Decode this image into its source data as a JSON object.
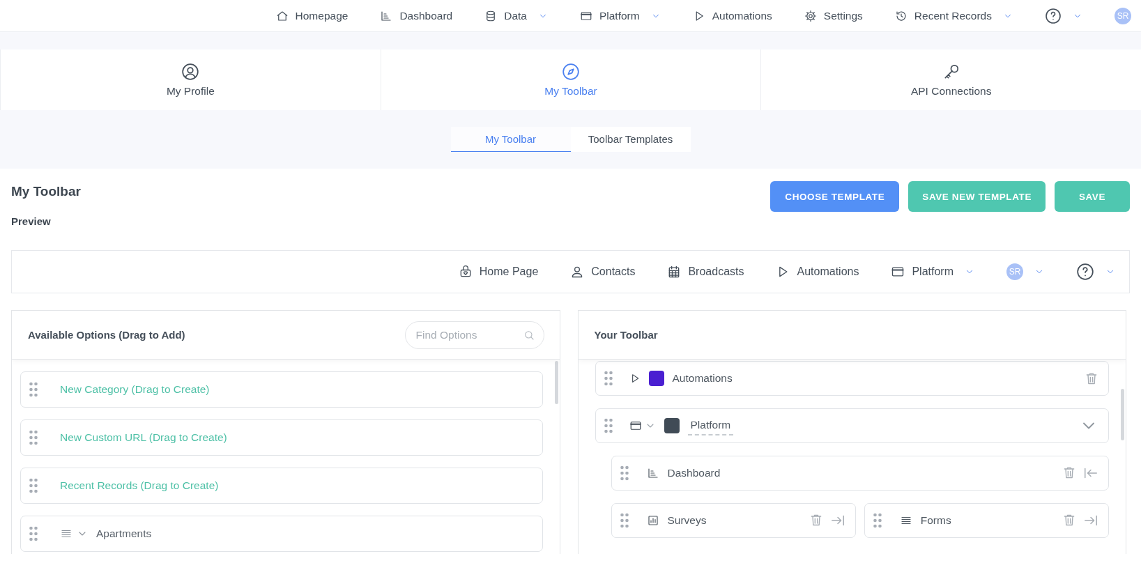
{
  "top_nav": {
    "items": [
      {
        "kind": "link",
        "label": "Homepage",
        "dropdown": false
      },
      {
        "kind": "link",
        "label": "Dashboard",
        "dropdown": false
      },
      {
        "kind": "link",
        "label": "Data",
        "dropdown": true
      },
      {
        "kind": "link",
        "label": "Platform",
        "dropdown": true
      },
      {
        "kind": "link",
        "label": "Automations",
        "dropdown": false
      },
      {
        "kind": "link",
        "label": "Settings",
        "dropdown": false
      },
      {
        "kind": "link",
        "label": "Recent Records",
        "dropdown": true
      },
      {
        "kind": "help",
        "dropdown": true
      },
      {
        "kind": "avatar",
        "label": "SR",
        "dropdown": false
      }
    ]
  },
  "profile_tabs": [
    {
      "label": "My Profile",
      "selected": false
    },
    {
      "label": "My Toolbar",
      "selected": true
    },
    {
      "label": "API Connections",
      "selected": false
    }
  ],
  "sub_tabs": [
    {
      "label": "My Toolbar",
      "selected": true
    },
    {
      "label": "Toolbar Templates",
      "selected": false
    }
  ],
  "page": {
    "title": "My Toolbar",
    "buttons": [
      {
        "label": "CHOOSE TEMPLATE",
        "kind": "primary"
      },
      {
        "label": "SAVE NEW TEMPLATE",
        "kind": "success"
      },
      {
        "label": "SAVE",
        "kind": "success"
      }
    ],
    "preview_label": "Preview"
  },
  "preview": {
    "items": [
      {
        "kind": "link",
        "label": "Home Page",
        "dropdown": false
      },
      {
        "kind": "link",
        "label": "Contacts",
        "dropdown": false
      },
      {
        "kind": "link",
        "label": "Broadcasts",
        "dropdown": false
      },
      {
        "kind": "link",
        "label": "Automations",
        "dropdown": false
      },
      {
        "kind": "link",
        "label": "Platform",
        "dropdown": true
      },
      {
        "kind": "avatar",
        "label": "SR",
        "dropdown": true
      },
      {
        "kind": "help",
        "dropdown": true
      }
    ]
  },
  "available_options": {
    "title": "Available Options (Drag to Add)",
    "search": {
      "placeholder": "Find Options"
    },
    "items": [
      {
        "kind": "create",
        "label": "New Category (Drag to Create)"
      },
      {
        "kind": "create",
        "label": "New Custom URL (Drag to Create)"
      },
      {
        "kind": "create",
        "label": "Recent Records (Drag to Create)"
      },
      {
        "kind": "category",
        "label": "Apartments"
      }
    ]
  },
  "your_toolbar": {
    "title": "Your Toolbar",
    "items": [
      {
        "kind": "item",
        "label": "Automations",
        "color": "#4a1fd1"
      },
      {
        "kind": "category",
        "label": "Platform",
        "color": "#404b56",
        "children": [
          {
            "kind": "full",
            "label": "Dashboard"
          },
          {
            "kind": "half",
            "label": "Surveys"
          },
          {
            "kind": "half",
            "label": "Forms"
          }
        ]
      }
    ]
  }
}
